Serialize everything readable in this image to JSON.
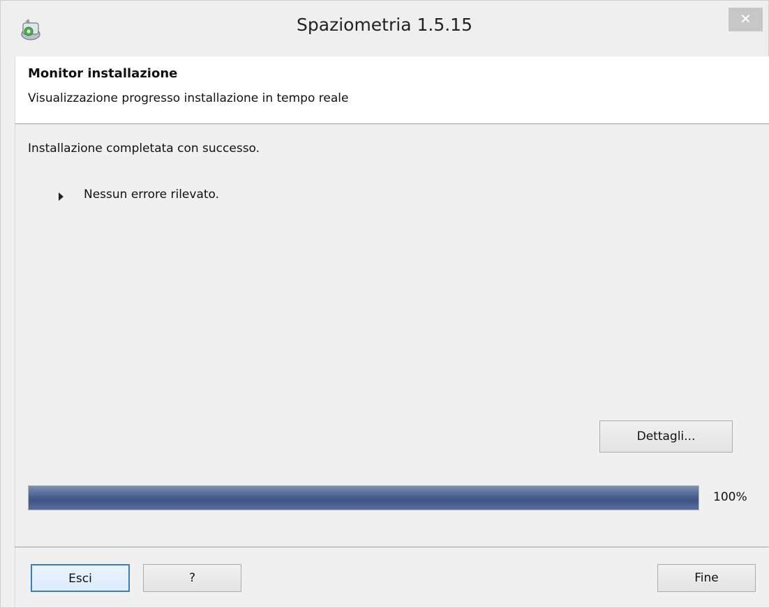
{
  "window": {
    "title": "Spaziometria 1.5.15",
    "close_glyph": "✕",
    "app_icon": "installer-app-icon"
  },
  "header": {
    "title": "Monitor installazione",
    "subtitle": "Visualizzazione progresso installazione in tempo reale"
  },
  "body": {
    "status": "Installazione completata con successo.",
    "tree_items": [
      {
        "label": "Nessun errore rilevato.",
        "expand_icon": "triangle-right-icon"
      }
    ],
    "details_button": "Dettagli..."
  },
  "progress": {
    "percent": 100,
    "label": "100%"
  },
  "footer": {
    "exit_button": "Esci",
    "help_button": "?",
    "finish_button": "Fine"
  },
  "colors": {
    "progress_fill": "#4f6594",
    "focus_border": "#3c7fb1",
    "close_button_bg": "#c7c7c7"
  }
}
